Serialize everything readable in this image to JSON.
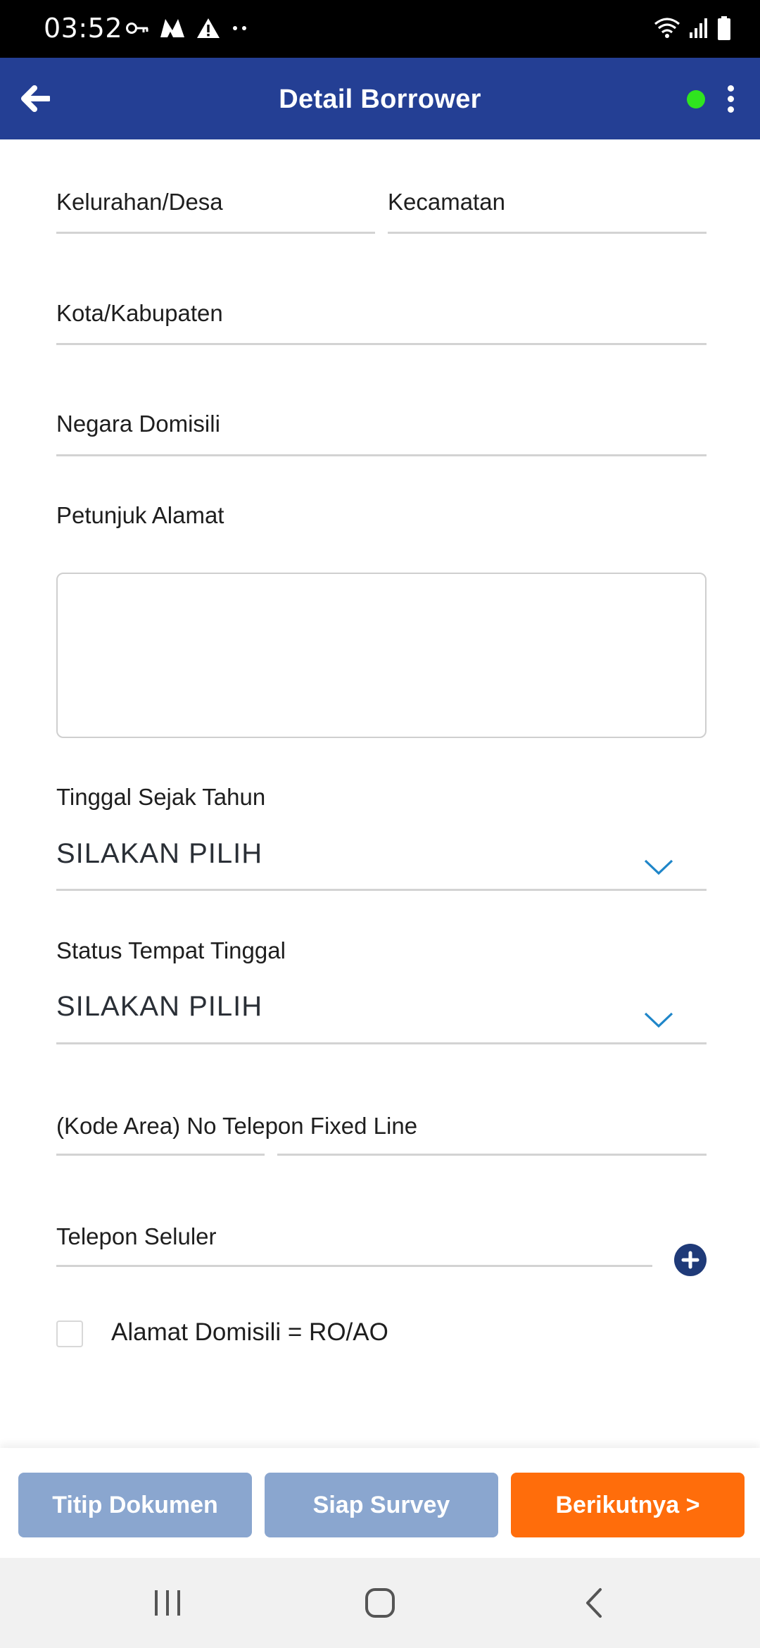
{
  "status_bar": {
    "time": "03:52",
    "left_icons": [
      "key-icon",
      "m-logo-icon",
      "warning-icon",
      "more-dots-icon"
    ],
    "right_icons": [
      "wifi-icon",
      "signal-icon",
      "battery-icon"
    ]
  },
  "app_bar": {
    "title": "Detail Borrower",
    "status_color": "#2fe51f",
    "background": "#243f94"
  },
  "form": {
    "kelurahan_label": "Kelurahan/Desa",
    "kecamatan_label": "Kecamatan",
    "kota_label": "Kota/Kabupaten",
    "negara_label": "Negara Domisili",
    "petunjuk_label": "Petunjuk Alamat",
    "petunjuk_value": "",
    "tinggal_sejak": {
      "label": "Tinggal Sejak Tahun",
      "value": "SILAKAN PILIH"
    },
    "status_tempat": {
      "label": "Status Tempat Tinggal",
      "value": "SILAKAN PILIH"
    },
    "telepon_fixed_label": "(Kode Area) No Telepon Fixed Line",
    "telepon_seluler_label": "Telepon Seluler",
    "alamat_domisili_checkbox": {
      "label": "Alamat Domisili = RO/AO",
      "checked": false
    }
  },
  "actions": {
    "titip_dokumen": "Titip Dokumen",
    "siap_survey": "Siap Survey",
    "berikutnya": "Berikutnya >",
    "primary_color": "#ff6d0b",
    "disabled_color": "#8aa6cf"
  },
  "nav_bar": {
    "icons": [
      "recent-apps-icon",
      "home-icon",
      "back-nav-icon"
    ]
  }
}
